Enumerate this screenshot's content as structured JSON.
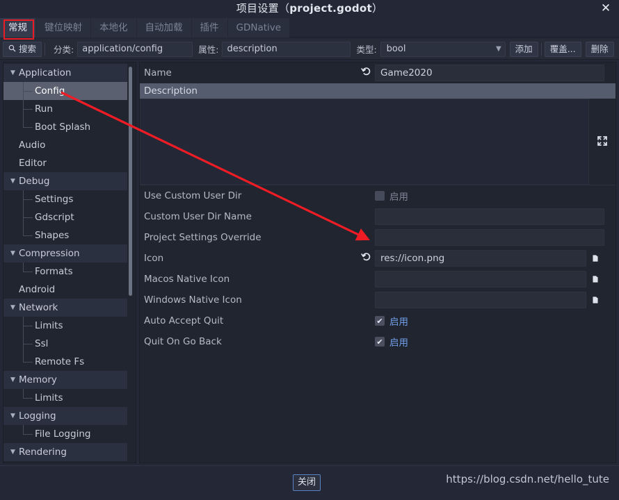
{
  "window": {
    "title_prefix": "项目设置（",
    "title_file": "project.godot",
    "title_suffix": "）",
    "close_icon": "close-icon"
  },
  "tabs": [
    {
      "label": "常规",
      "active": true
    },
    {
      "label": "键位映射",
      "active": false
    },
    {
      "label": "本地化",
      "active": false
    },
    {
      "label": "自动加载",
      "active": false
    },
    {
      "label": "插件",
      "active": false
    },
    {
      "label": "GDNative",
      "active": false
    }
  ],
  "toolbar": {
    "search_label": "搜索",
    "search_icon": "search-icon",
    "category_label": "分类:",
    "category_value": "application/config",
    "property_label": "属性:",
    "property_value": "description",
    "type_label": "类型:",
    "type_value": "bool",
    "add_label": "添加",
    "override_label": "覆盖...",
    "delete_label": "删除"
  },
  "sidebar": {
    "items": [
      {
        "label": "Application",
        "level": 0,
        "group": true,
        "selected": false
      },
      {
        "label": "Config",
        "level": 1,
        "group": false,
        "selected": true
      },
      {
        "label": "Run",
        "level": 1,
        "group": false,
        "selected": false
      },
      {
        "label": "Boot Splash",
        "level": 1,
        "group": false,
        "selected": false
      },
      {
        "label": "Audio",
        "level": 0,
        "group": false,
        "selected": false
      },
      {
        "label": "Editor",
        "level": 0,
        "group": false,
        "selected": false
      },
      {
        "label": "Debug",
        "level": 0,
        "group": true,
        "selected": false
      },
      {
        "label": "Settings",
        "level": 1,
        "group": false,
        "selected": false
      },
      {
        "label": "Gdscript",
        "level": 1,
        "group": false,
        "selected": false
      },
      {
        "label": "Shapes",
        "level": 1,
        "group": false,
        "selected": false
      },
      {
        "label": "Compression",
        "level": 0,
        "group": true,
        "selected": false
      },
      {
        "label": "Formats",
        "level": 1,
        "group": false,
        "selected": false
      },
      {
        "label": "Android",
        "level": 0,
        "group": false,
        "selected": false
      },
      {
        "label": "Network",
        "level": 0,
        "group": true,
        "selected": false
      },
      {
        "label": "Limits",
        "level": 1,
        "group": false,
        "selected": false
      },
      {
        "label": "Ssl",
        "level": 1,
        "group": false,
        "selected": false
      },
      {
        "label": "Remote Fs",
        "level": 1,
        "group": false,
        "selected": false
      },
      {
        "label": "Memory",
        "level": 0,
        "group": true,
        "selected": false
      },
      {
        "label": "Limits",
        "level": 1,
        "group": false,
        "selected": false
      },
      {
        "label": "Logging",
        "level": 0,
        "group": true,
        "selected": false
      },
      {
        "label": "File Logging",
        "level": 1,
        "group": false,
        "selected": false
      },
      {
        "label": "Rendering",
        "level": 0,
        "group": true,
        "selected": false
      }
    ]
  },
  "properties": {
    "name_row": {
      "label": "Name",
      "value": "Game2020",
      "revert_icon": "revert-icon"
    },
    "description_header": "Description",
    "description_value": "",
    "expand_icon": "expand-icon",
    "rows": [
      {
        "label": "Use Custom User Dir",
        "kind": "checkbox",
        "checked": false,
        "check_text": "启用"
      },
      {
        "label": "Custom User Dir Name",
        "kind": "text",
        "value": ""
      },
      {
        "label": "Project Settings Override",
        "kind": "text",
        "value": ""
      },
      {
        "label": "Icon",
        "kind": "file",
        "value": "res://icon.png",
        "revert": true,
        "folder_icon": "folder-icon"
      },
      {
        "label": "Macos Native Icon",
        "kind": "file",
        "value": "",
        "revert": false,
        "folder_icon": "folder-icon"
      },
      {
        "label": "Windows Native Icon",
        "kind": "file",
        "value": "",
        "revert": false,
        "folder_icon": "folder-icon"
      },
      {
        "label": "Auto Accept Quit",
        "kind": "checkbox",
        "checked": true,
        "check_text": "启用"
      },
      {
        "label": "Quit On Go Back",
        "kind": "checkbox",
        "checked": true,
        "check_text": "启用"
      }
    ]
  },
  "footer": {
    "close_label": "关闭",
    "watermark": "https://blog.csdn.net/hello_tute"
  },
  "colors": {
    "window_bg": "#242836",
    "panel_bg": "#21252f",
    "accent_blue": "#6f9ee8",
    "annotation_red": "#ec1c24",
    "selected_row": "#5a6070",
    "section_head": "#555c6e"
  }
}
